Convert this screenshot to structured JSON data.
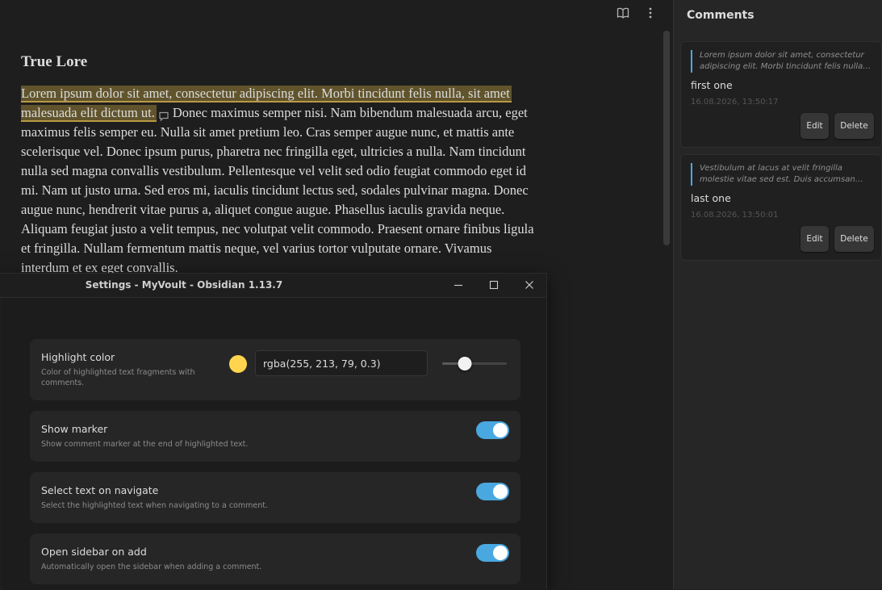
{
  "editor": {
    "actions": [
      {
        "name": "reading-view-icon"
      },
      {
        "name": "more-options-icon"
      }
    ],
    "title": "True Lore",
    "highlighted_text": "Lorem ipsum dolor sit amet, consectetur adipiscing elit. Morbi tincidunt felis nulla, sit amet malesuada elit dictum ut.",
    "body_text": "Donec maximus semper nisi. Nam bibendum malesuada arcu, eget maximus felis semper eu. Nulla sit amet pretium leo. Cras semper augue nunc, et mattis ante scelerisque vel. Donec ipsum purus, pharetra nec fringilla eget, ultricies a nulla. Nam tincidunt nulla sed magna convallis vestibulum. Pellentesque vel velit sed odio feugiat commodo eget id mi. Nam ut justo urna. Sed eros mi, iaculis tincidunt lectus sed, sodales pulvinar magna. Donec augue nunc, hendrerit vitae purus a, aliquet congue augue. Phasellus iaculis gravida neque. Aliquam feugiat justo a velit tempus, nec volutpat velit commodo. Praesent ornare finibus ligula et fringilla. Nullam fermentum mattis neque, vel varius tortor vulputate ornare. Vivamus interdum et ex eget convallis."
  },
  "sidebar": {
    "title": "Comments",
    "comments": [
      {
        "quote": "Lorem ipsum dolor sit amet, consectetur adipiscing elit. Morbi tincidunt felis nulla, sit amet malesuada elit dictum ut.",
        "text": "first one",
        "time": "16.08.2026, 13:50:17",
        "edit_label": "Edit",
        "delete_label": "Delete"
      },
      {
        "quote": "Vestibulum at lacus at velit fringilla molestie vitae sed est. Duis accumsan tristique consequat.",
        "text": "last one",
        "time": "16.08.2026, 13:50:01",
        "edit_label": "Edit",
        "delete_label": "Delete"
      }
    ]
  },
  "settings_window": {
    "title": "Settings - MyVoult - Obsidian 1.13.7",
    "controls": [
      "minimize-icon",
      "maximize-icon",
      "close-icon"
    ],
    "highlight_color": {
      "name": "Highlight color",
      "desc": "Color of highlighted text fragments with comments.",
      "swatch_color": "#ffd54f",
      "value": "rgba(255, 213, 79, 0.3)",
      "opacity": 0.35
    },
    "show_marker": {
      "name": "Show marker",
      "desc": "Show comment marker at the end of highlighted text.",
      "enabled": true
    },
    "select_on_navigate": {
      "name": "Select text on navigate",
      "desc": "Select the highlighted text when navigating to a comment.",
      "enabled": true
    },
    "open_sidebar": {
      "name": "Open sidebar on add",
      "desc": "Automatically open the sidebar when adding a comment.",
      "enabled": true
    }
  },
  "colors": {
    "accent": "#4aa8e0",
    "highlight": "rgba(255, 213, 79, 0.3)",
    "background": "#1e1e1e",
    "sidebar": "#262626"
  }
}
